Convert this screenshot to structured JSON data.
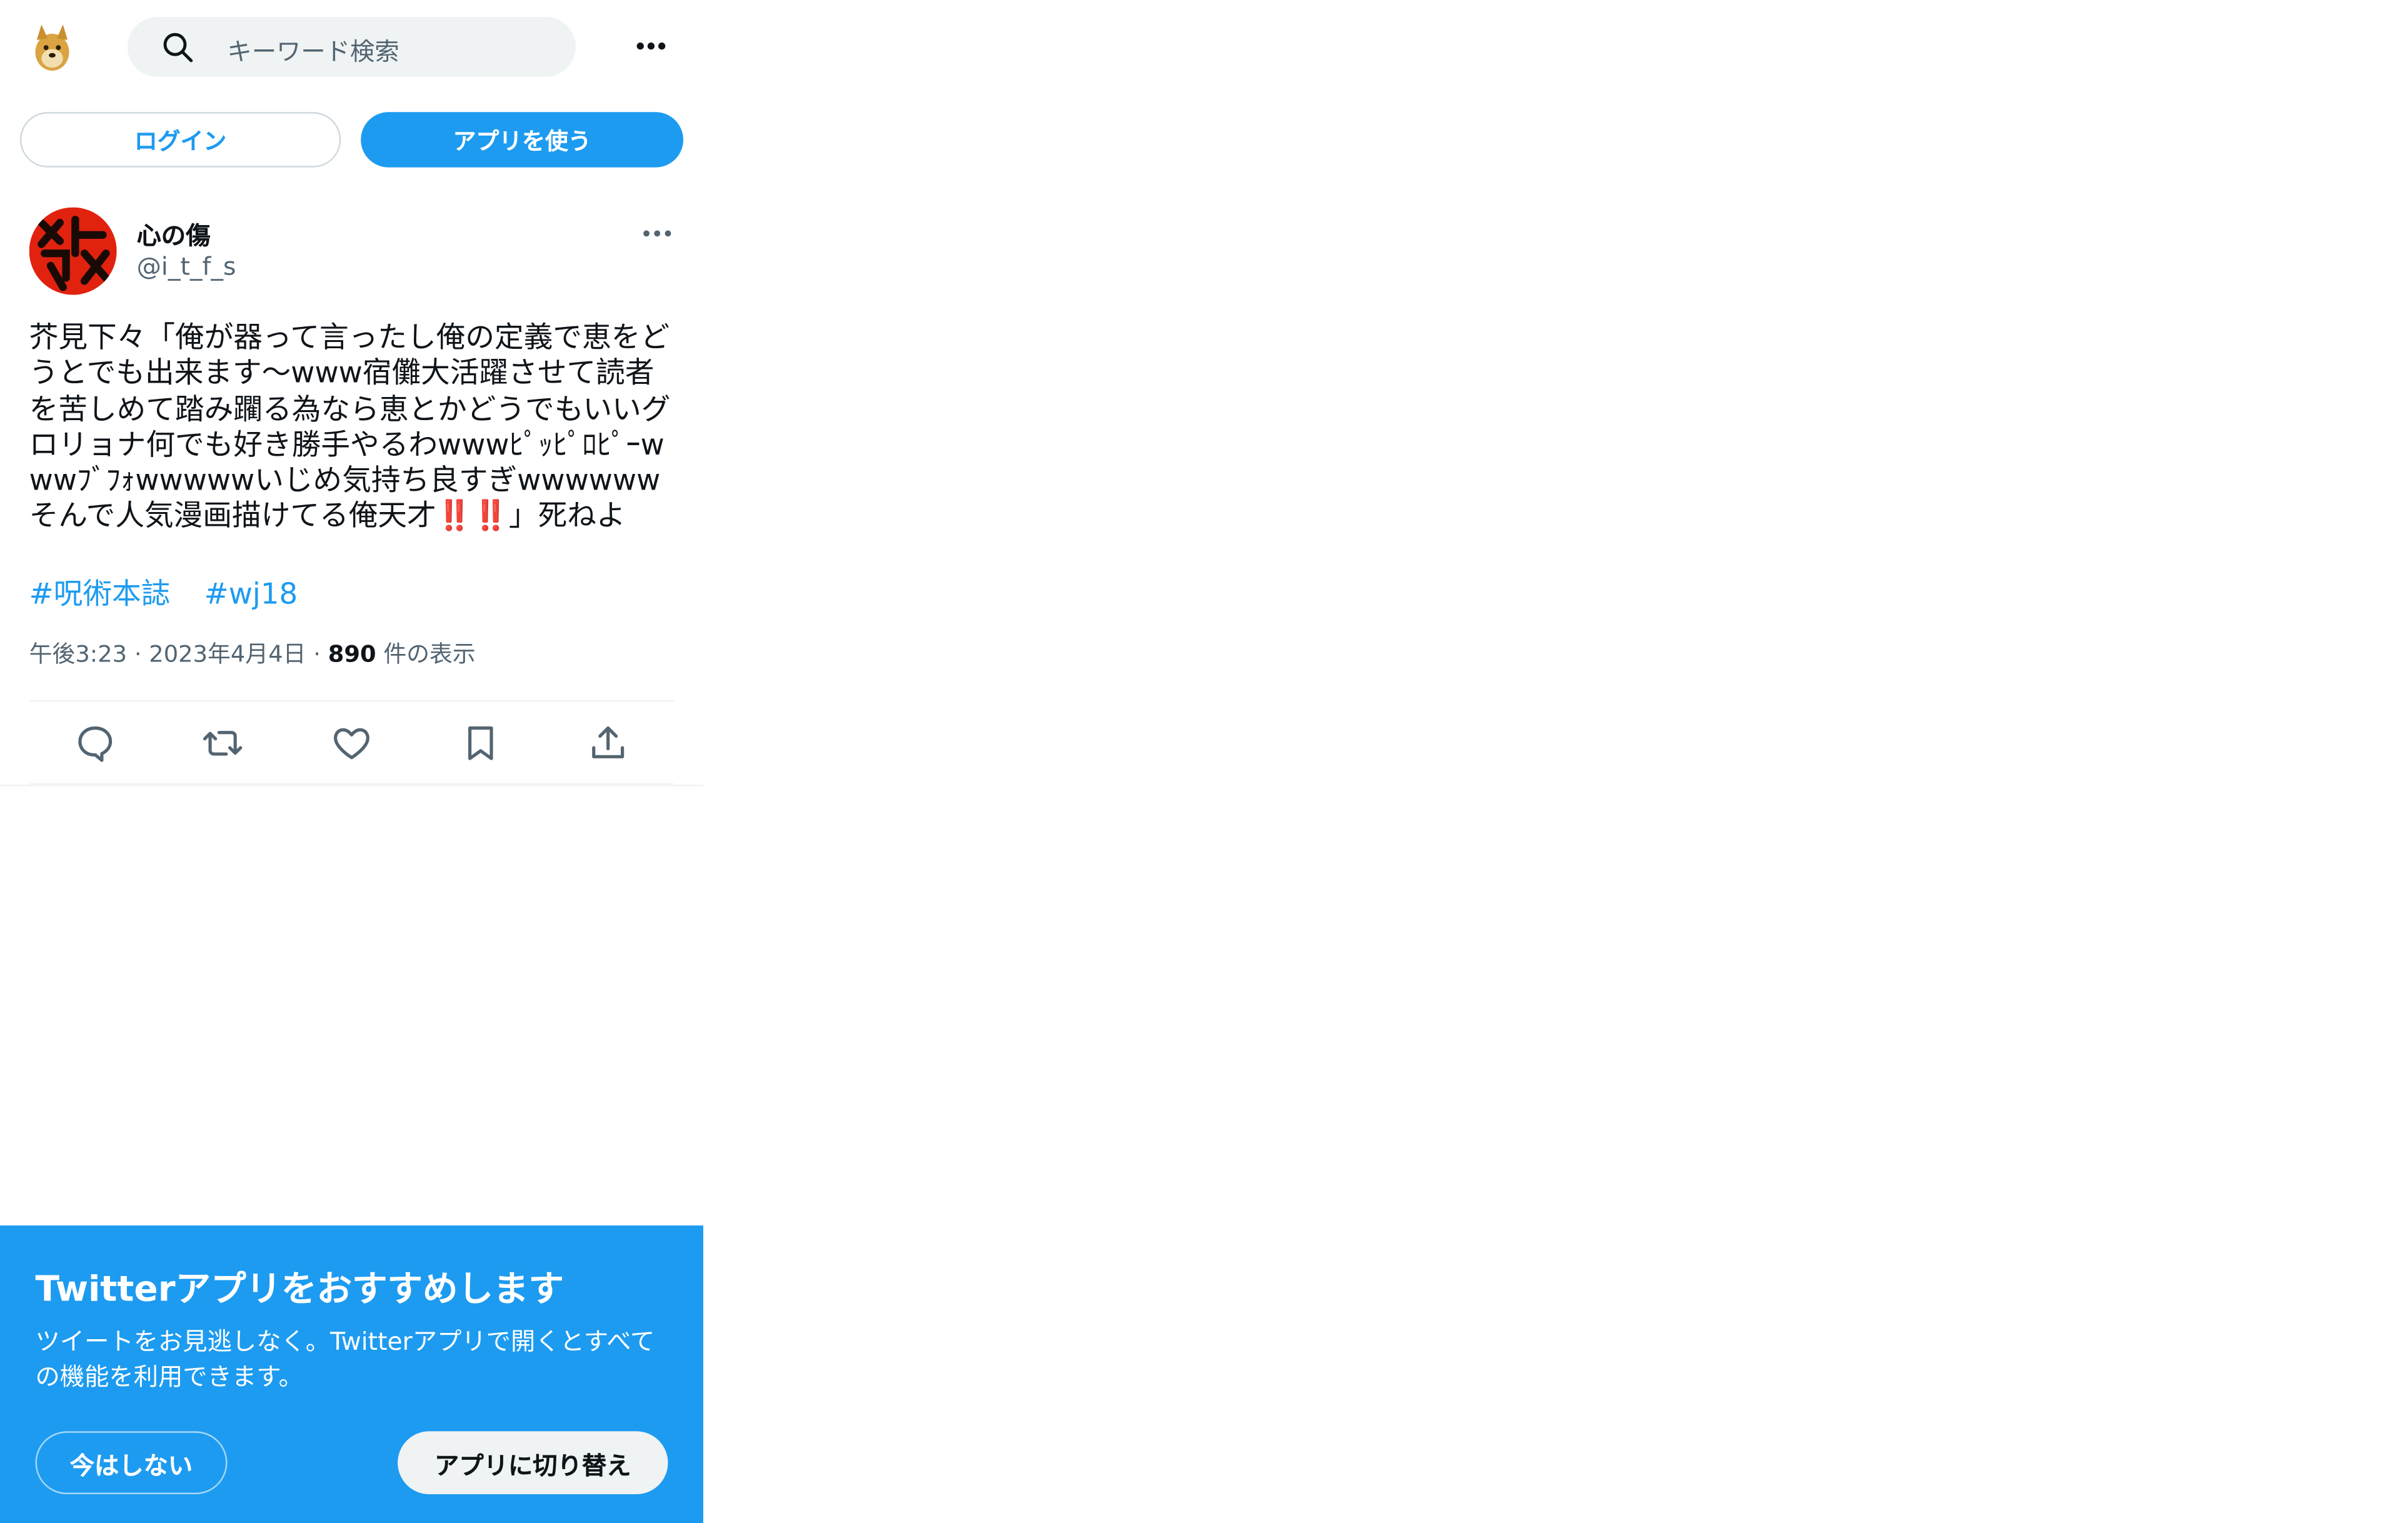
{
  "header": {
    "logo_icon": "doge-logo-icon",
    "search": {
      "placeholder": "キーワード検索",
      "icon": "search-icon"
    },
    "more_icon": "more-icon"
  },
  "auth": {
    "login_label": "ログイン",
    "use_app_label": "アプリを使う"
  },
  "tweet": {
    "avatar_icon": "avatar-icon",
    "display_name": "心の傷",
    "handle": "@i_t_f_s",
    "text": "芥見下々「俺が器って言ったし俺の定義で恵をどうとでも出来ます〜www宿儺大活躍させて読者を苦しめて踏み躙る為なら恵とかどうでもいいグロリョナ何でも好き勝手やるわwwwﾋﾟｯﾋﾟﾛﾋﾟｰwwwﾌﾞﾌｫwwwwwいじめ気持ち良すぎwwwwwwそんで人気漫画描けてる俺天才‼️‼️」死ねよ",
    "hashtags": [
      "#呪術本誌",
      "#wj18"
    ],
    "meta": {
      "time": "午後3:23",
      "date": "2023年4月4日",
      "views_count": "890",
      "views_label": "件の表示"
    },
    "actions": [
      "reply-icon",
      "retweet-icon",
      "like-icon",
      "bookmark-icon",
      "share-icon"
    ]
  },
  "promo": {
    "title": "Twitterアプリをおすすめします",
    "body": "ツイートをお見逃しなく。Twitterアプリで開くとすべての機能を利用できます。",
    "not_now_label": "今はしない",
    "switch_label": "アプリに切り替え"
  },
  "colors": {
    "accent": "#1d9bf0",
    "text": "#0f1419",
    "secondary": "#536471"
  }
}
